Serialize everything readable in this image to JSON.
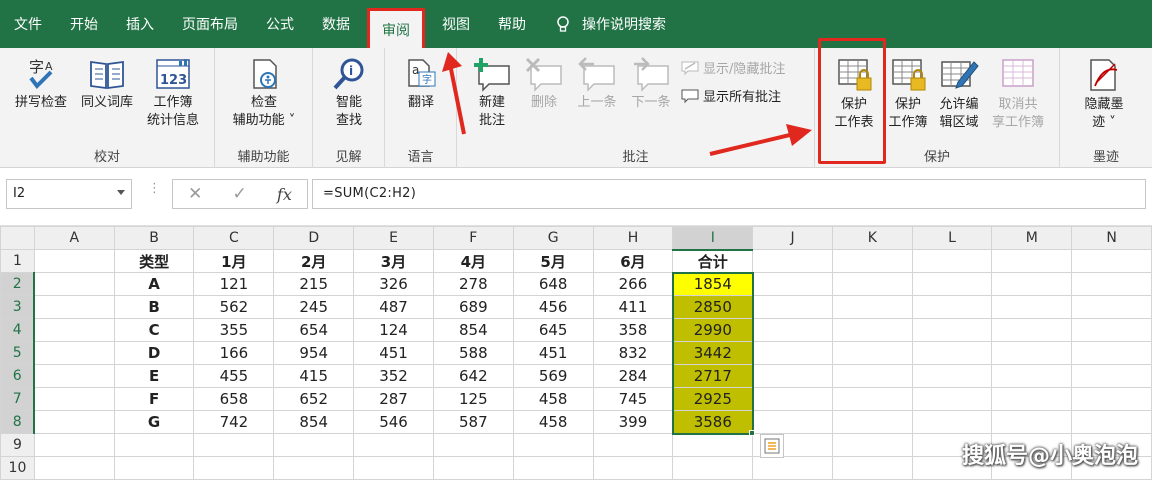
{
  "tabs": [
    "文件",
    "开始",
    "插入",
    "页面布局",
    "公式",
    "数据",
    "审阅",
    "视图",
    "帮助"
  ],
  "active_tab": "审阅",
  "tell_me": "操作说明搜索",
  "ribbon": {
    "proofing": {
      "label": "校对",
      "spelling": "拼写检查",
      "thesaurus": "同义词库",
      "stats_line1": "工作簿",
      "stats_line2": "统计信息"
    },
    "accessibility": {
      "label": "辅助功能",
      "check_line1": "检查",
      "check_line2": "辅助功能 ˅"
    },
    "insights": {
      "label": "见解",
      "smart_line1": "智能",
      "smart_line2": "查找"
    },
    "language": {
      "label": "语言",
      "translate": "翻译"
    },
    "comments": {
      "label": "批注",
      "new_line1": "新建",
      "new_line2": "批注",
      "delete": "删除",
      "prev": "上一条",
      "next": "下一条",
      "show_hide": "显示/隐藏批注",
      "show_all": "显示所有批注"
    },
    "protect": {
      "label": "保护",
      "sheet_line1": "保护",
      "sheet_line2": "工作表",
      "book_line1": "保护",
      "book_line2": "工作簿",
      "edit_line1": "允许编",
      "edit_line2": "辑区域",
      "unshare_line1": "取消共",
      "unshare_line2": "享工作簿"
    },
    "ink": {
      "label": "墨迹",
      "hide_line1": "隐藏墨",
      "hide_line2": "迹 ˅"
    }
  },
  "formula_bar": {
    "name_box": "I2",
    "formula": "=SUM(C2:H2)",
    "fx": "fx"
  },
  "columns": [
    "A",
    "B",
    "C",
    "D",
    "E",
    "F",
    "G",
    "H",
    "I",
    "J",
    "K",
    "L",
    "M",
    "N"
  ],
  "row_numbers": [
    "1",
    "2",
    "3",
    "4",
    "5",
    "6",
    "7",
    "8",
    "9",
    "10"
  ],
  "header_row": [
    "类型",
    "1月",
    "2月",
    "3月",
    "4月",
    "5月",
    "6月",
    "合计"
  ],
  "rows": [
    [
      "A",
      "121",
      "215",
      "326",
      "278",
      "648",
      "266",
      "1854"
    ],
    [
      "B",
      "562",
      "245",
      "487",
      "689",
      "456",
      "411",
      "2850"
    ],
    [
      "C",
      "355",
      "654",
      "124",
      "854",
      "645",
      "358",
      "2990"
    ],
    [
      "D",
      "166",
      "954",
      "451",
      "588",
      "451",
      "832",
      "3442"
    ],
    [
      "E",
      "455",
      "415",
      "352",
      "642",
      "569",
      "284",
      "2717"
    ],
    [
      "F",
      "658",
      "652",
      "287",
      "125",
      "458",
      "745",
      "2925"
    ],
    [
      "G",
      "742",
      "854",
      "546",
      "587",
      "458",
      "399",
      "3586"
    ]
  ],
  "watermark": "搜狐号@小奥泡泡",
  "colors": {
    "excel_green": "#217346",
    "highlight": "#e0281f",
    "yellow": "#ffff00",
    "olive": "#bfbf00"
  }
}
